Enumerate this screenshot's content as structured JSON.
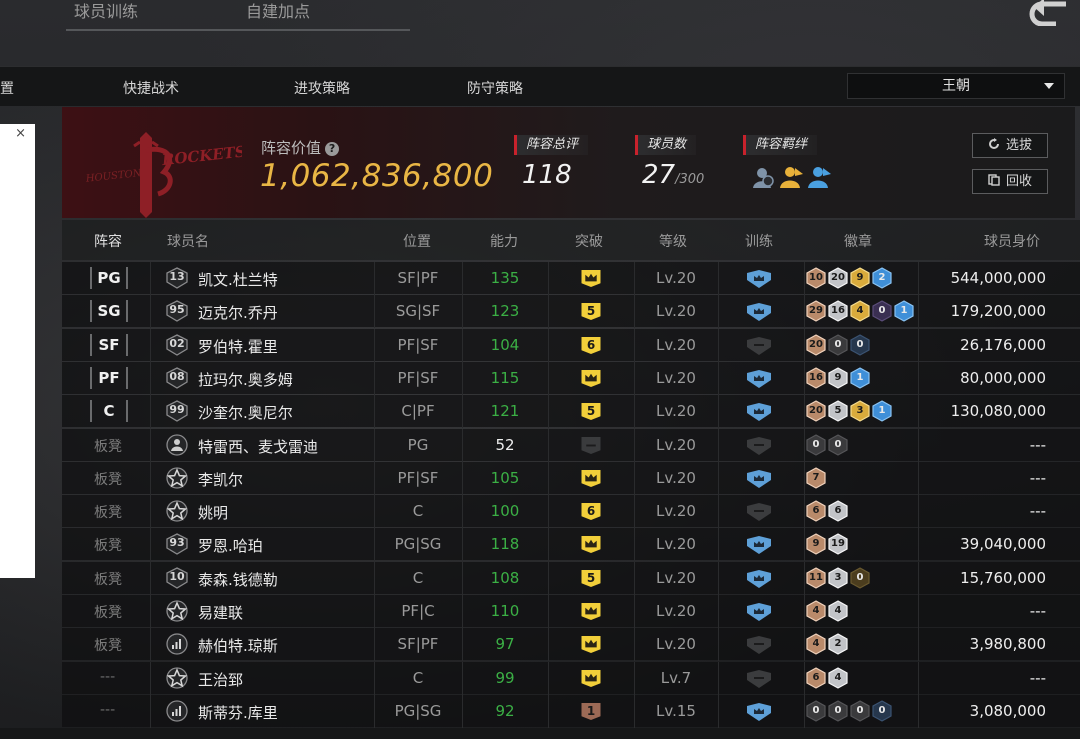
{
  "top_tabs": [
    "球员训练",
    "自建加点"
  ],
  "subnav": {
    "partial_label": "置",
    "items": [
      "快捷战术",
      "进攻策略",
      "防守策略"
    ]
  },
  "dynasty_select": {
    "value": "王朝"
  },
  "side_panel": {
    "close": "×"
  },
  "header": {
    "lineup_value_label": "阵容价值",
    "help_icon": "?",
    "lineup_value": "1,062,836,800",
    "overall_label": "阵容总评",
    "overall_value": "118",
    "player_count_label": "球员数",
    "player_count_value": "27",
    "player_count_max": "/300",
    "bond_label": "阵容羁绊",
    "scout_button": "选拔",
    "recycle_button": "回收",
    "logo_text": "ROCKETS",
    "logo_city": "HOUSTON"
  },
  "table": {
    "headers": [
      "阵容",
      "球员名",
      "位置",
      "能力",
      "突破",
      "等级",
      "训练",
      "徽章",
      "球员身价"
    ],
    "rows": [
      {
        "slot": "PG",
        "slot_type": "starter",
        "jersey": "13",
        "jersey_type": "num",
        "name": "凯文.杜兰特",
        "position": "SF|PF",
        "rating": "135",
        "rating_color": "green",
        "breakthrough": "crown",
        "level": "Lv.20",
        "training": "blue",
        "badges": [
          {
            "n": "10",
            "c": "bronze"
          },
          {
            "n": "20",
            "c": "silver"
          },
          {
            "n": "9",
            "c": "gold"
          },
          {
            "n": "2",
            "c": "blue"
          }
        ],
        "value": "544,000,000"
      },
      {
        "slot": "SG",
        "slot_type": "starter",
        "jersey": "95",
        "jersey_type": "num",
        "name": "迈克尔.乔丹",
        "position": "SG|SF",
        "rating": "123",
        "rating_color": "green",
        "breakthrough": "5",
        "level": "Lv.20",
        "training": "blue",
        "badges": [
          {
            "n": "29",
            "c": "bronze"
          },
          {
            "n": "16",
            "c": "silver"
          },
          {
            "n": "4",
            "c": "gold"
          },
          {
            "n": "0",
            "c": "purple"
          },
          {
            "n": "1",
            "c": "blue"
          }
        ],
        "value": "179,200,000"
      },
      {
        "slot": "SF",
        "slot_type": "starter",
        "jersey": "02",
        "jersey_type": "num",
        "name": "罗伯特.霍里",
        "position": "PF|SF",
        "rating": "104",
        "rating_color": "green",
        "breakthrough": "6",
        "level": "Lv.20",
        "training": "gray",
        "badges": [
          {
            "n": "20",
            "c": "bronze"
          },
          {
            "n": "0",
            "c": "dark"
          },
          {
            "n": "0",
            "c": "darkblue"
          }
        ],
        "value": "26,176,000"
      },
      {
        "slot": "PF",
        "slot_type": "starter",
        "jersey": "08",
        "jersey_type": "num",
        "name": "拉玛尔.奥多姆",
        "position": "PF|SF",
        "rating": "115",
        "rating_color": "green",
        "breakthrough": "crown",
        "level": "Lv.20",
        "training": "blue",
        "badges": [
          {
            "n": "16",
            "c": "bronze"
          },
          {
            "n": "9",
            "c": "silver"
          },
          {
            "n": "1",
            "c": "blue"
          }
        ],
        "value": "80,000,000"
      },
      {
        "slot": "C",
        "slot_type": "starter",
        "jersey": "99",
        "jersey_type": "num",
        "name": "沙奎尔.奥尼尔",
        "position": "C|PF",
        "rating": "121",
        "rating_color": "green",
        "breakthrough": "5",
        "level": "Lv.20",
        "training": "blue",
        "badges": [
          {
            "n": "20",
            "c": "bronze"
          },
          {
            "n": "5",
            "c": "silver"
          },
          {
            "n": "3",
            "c": "gold"
          },
          {
            "n": "1",
            "c": "blue"
          }
        ],
        "value": "130,080,000"
      },
      {
        "slot": "板凳",
        "slot_type": "bench",
        "jersey": "",
        "jersey_type": "person",
        "name": "特雷西、麦戈雷迪",
        "position": "PG",
        "rating": "52",
        "rating_color": "white",
        "breakthrough": "none",
        "level": "Lv.20",
        "training": "gray",
        "badges": [
          {
            "n": "0",
            "c": "dark"
          },
          {
            "n": "0",
            "c": "dark"
          }
        ],
        "value": "---"
      },
      {
        "slot": "板凳",
        "slot_type": "bench",
        "jersey": "",
        "jersey_type": "star",
        "name": "李凯尔",
        "position": "PF|SF",
        "rating": "105",
        "rating_color": "green",
        "breakthrough": "crown",
        "level": "Lv.20",
        "training": "blue",
        "badges": [
          {
            "n": "7",
            "c": "bronze"
          }
        ],
        "value": "---"
      },
      {
        "slot": "板凳",
        "slot_type": "bench",
        "jersey": "",
        "jersey_type": "star",
        "name": "姚明",
        "position": "C",
        "rating": "100",
        "rating_color": "green",
        "breakthrough": "6",
        "level": "Lv.20",
        "training": "gray",
        "badges": [
          {
            "n": "6",
            "c": "bronze"
          },
          {
            "n": "6",
            "c": "silver"
          }
        ],
        "value": "---"
      },
      {
        "slot": "板凳",
        "slot_type": "bench",
        "jersey": "93",
        "jersey_type": "num",
        "name": "罗恩.哈珀",
        "position": "PG|SG",
        "rating": "118",
        "rating_color": "green",
        "breakthrough": "crown",
        "level": "Lv.20",
        "training": "blue",
        "badges": [
          {
            "n": "9",
            "c": "bronze"
          },
          {
            "n": "19",
            "c": "silver"
          }
        ],
        "value": "39,040,000"
      },
      {
        "slot": "板凳",
        "slot_type": "bench",
        "jersey": "10",
        "jersey_type": "num",
        "name": "泰森.钱德勒",
        "position": "C",
        "rating": "108",
        "rating_color": "green",
        "breakthrough": "5",
        "level": "Lv.20",
        "training": "blue",
        "badges": [
          {
            "n": "11",
            "c": "bronze"
          },
          {
            "n": "3",
            "c": "silver"
          },
          {
            "n": "0",
            "c": "darkgold"
          }
        ],
        "value": "15,760,000"
      },
      {
        "slot": "板凳",
        "slot_type": "bench",
        "jersey": "",
        "jersey_type": "star",
        "name": "易建联",
        "position": "PF|C",
        "rating": "110",
        "rating_color": "green",
        "breakthrough": "crown",
        "level": "Lv.20",
        "training": "blue",
        "badges": [
          {
            "n": "4",
            "c": "bronze"
          },
          {
            "n": "4",
            "c": "silver"
          }
        ],
        "value": "---"
      },
      {
        "slot": "板凳",
        "slot_type": "bench",
        "jersey": "",
        "jersey_type": "bars",
        "name": "赫伯特.琼斯",
        "position": "SF|PF",
        "rating": "97",
        "rating_color": "green",
        "breakthrough": "crown",
        "level": "Lv.20",
        "training": "gray",
        "badges": [
          {
            "n": "4",
            "c": "bronze"
          },
          {
            "n": "2",
            "c": "silver"
          }
        ],
        "value": "3,980,800"
      },
      {
        "slot": "---",
        "slot_type": "none",
        "jersey": "",
        "jersey_type": "star",
        "name": "王治郅",
        "position": "C",
        "rating": "99",
        "rating_color": "green",
        "breakthrough": "crown",
        "level": "Lv.7",
        "training": "gray",
        "badges": [
          {
            "n": "6",
            "c": "bronze"
          },
          {
            "n": "4",
            "c": "silver"
          }
        ],
        "value": "---"
      },
      {
        "slot": "---",
        "slot_type": "none",
        "jersey": "",
        "jersey_type": "bars",
        "name": "斯蒂芬.库里",
        "position": "PG|SG",
        "rating": "92",
        "rating_color": "green",
        "breakthrough": "1",
        "level": "Lv.15",
        "training": "blue",
        "badges": [
          {
            "n": "0",
            "c": "dark"
          },
          {
            "n": "0",
            "c": "dark"
          },
          {
            "n": "0",
            "c": "dark"
          },
          {
            "n": "0",
            "c": "darkblue"
          }
        ],
        "value": "3,080,000"
      }
    ]
  },
  "colors": {
    "accent_red": "#c8222c",
    "value_gold": "#e9b645",
    "rating_green": "#3bb045",
    "badge_yellow": "#f2cf3a",
    "train_blue": "#5ea0d8"
  }
}
